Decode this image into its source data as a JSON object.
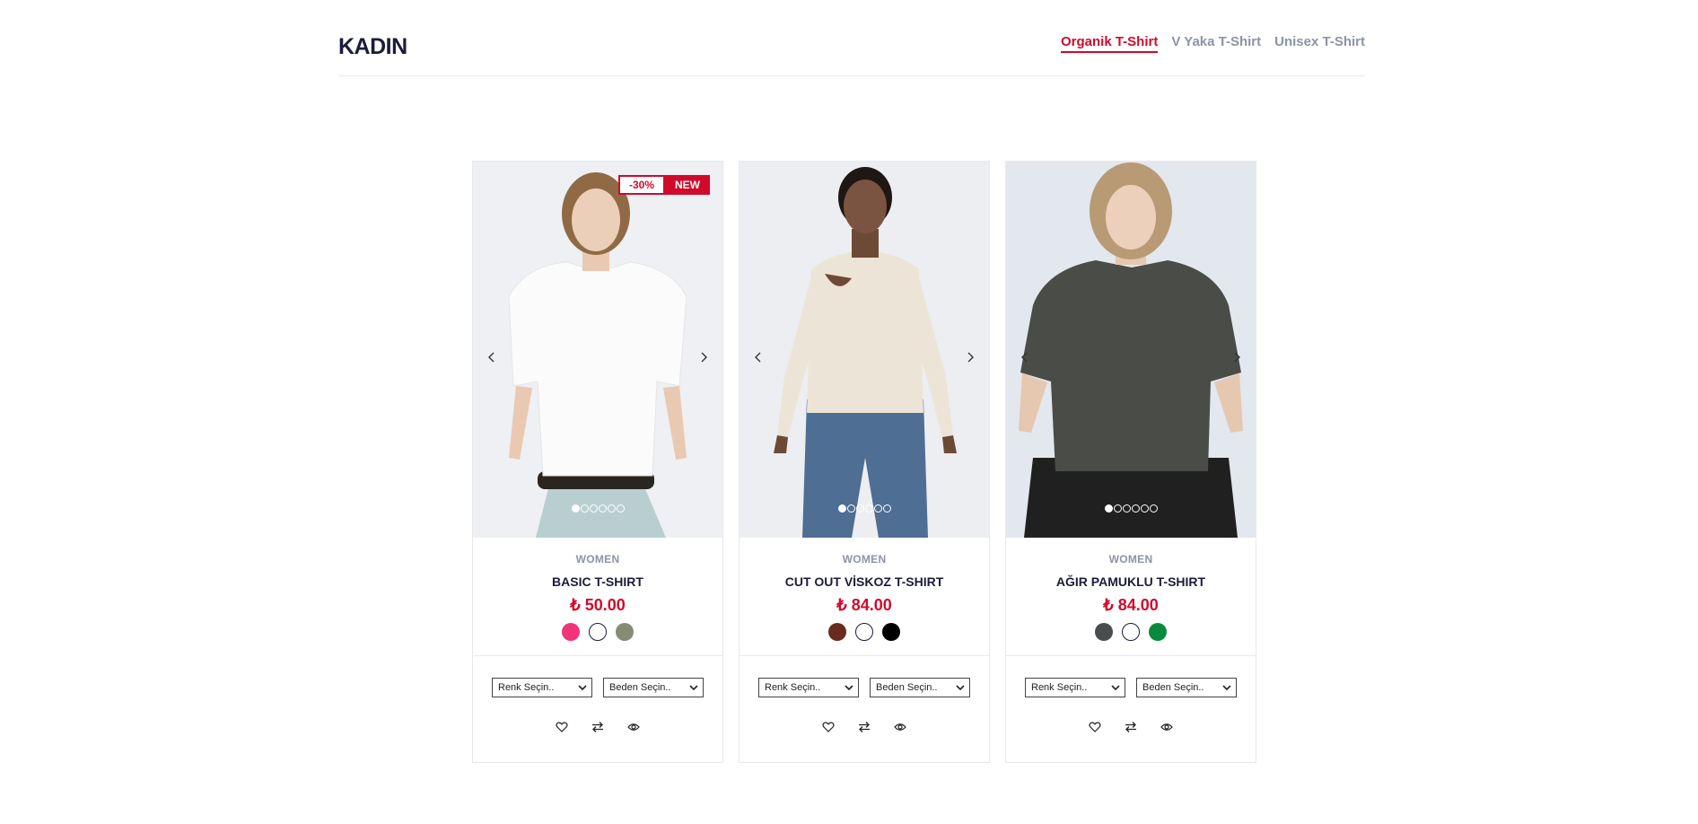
{
  "header": {
    "title": "KADIN",
    "tabs": [
      {
        "label": "Organik T-Shirt",
        "active": true
      },
      {
        "label": "V Yaka T-Shirt",
        "active": false
      },
      {
        "label": "Unisex T-Shirt",
        "active": false
      }
    ]
  },
  "colors": {
    "accent": "#d10a2a",
    "text": "#1c1c3a",
    "muted": "#8c93a6"
  },
  "products": [
    {
      "badges": {
        "discount": "-30%",
        "new": "NEW"
      },
      "brand": "WOMEN",
      "title": "BASIC T-SHIRT",
      "price": "₺ 50.00",
      "swatches": [
        "#f0357a",
        "#ffffff",
        "#858c73"
      ],
      "color_select": "Renk Seçin..",
      "size_select": "Beden Seçin..",
      "image_dots": 6,
      "active_dot": 0
    },
    {
      "brand": "WOMEN",
      "title": "CUT OUT VİSKOZ T-SHIRT",
      "price": "₺ 84.00",
      "swatches": [
        "#6b2a1e",
        "#ffffff",
        "#000000"
      ],
      "color_select": "Renk Seçin..",
      "size_select": "Beden Seçin..",
      "image_dots": 6,
      "active_dot": 0
    },
    {
      "brand": "WOMEN",
      "title": "AĞIR PAMUKLU T-SHIRT",
      "price": "₺ 84.00",
      "swatches": [
        "#4a4d4e",
        "#ffffff",
        "#0a8a3c"
      ],
      "color_select": "Renk Seçin..",
      "size_select": "Beden Seçin..",
      "image_dots": 6,
      "active_dot": 0
    }
  ]
}
